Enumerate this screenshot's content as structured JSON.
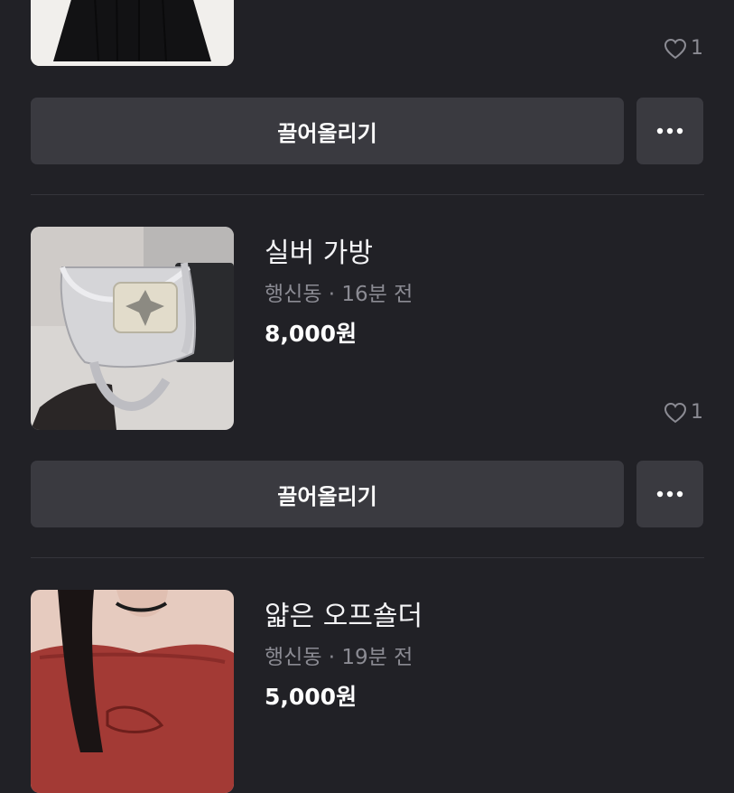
{
  "items": [
    {
      "title": "",
      "location": "",
      "time": "",
      "price": "",
      "likes": "1",
      "thumb_desc": "black-skirt"
    },
    {
      "title": "실버 가방",
      "location": "행신동",
      "time": "16분 전",
      "price": "8,000원",
      "likes": "1",
      "thumb_desc": "silver-bag"
    },
    {
      "title": "얇은 오프숄더",
      "location": "행신동",
      "time": "19분 전",
      "price": "5,000원",
      "likes": "",
      "thumb_desc": "red-off-shoulder-top"
    }
  ],
  "actions": {
    "bump_label": "끌어올리기",
    "more_label": "..."
  },
  "meta_separator": "·",
  "colors": {
    "background": "#212126",
    "button_bg": "#3a3a40",
    "muted_text": "#8b8b93"
  }
}
